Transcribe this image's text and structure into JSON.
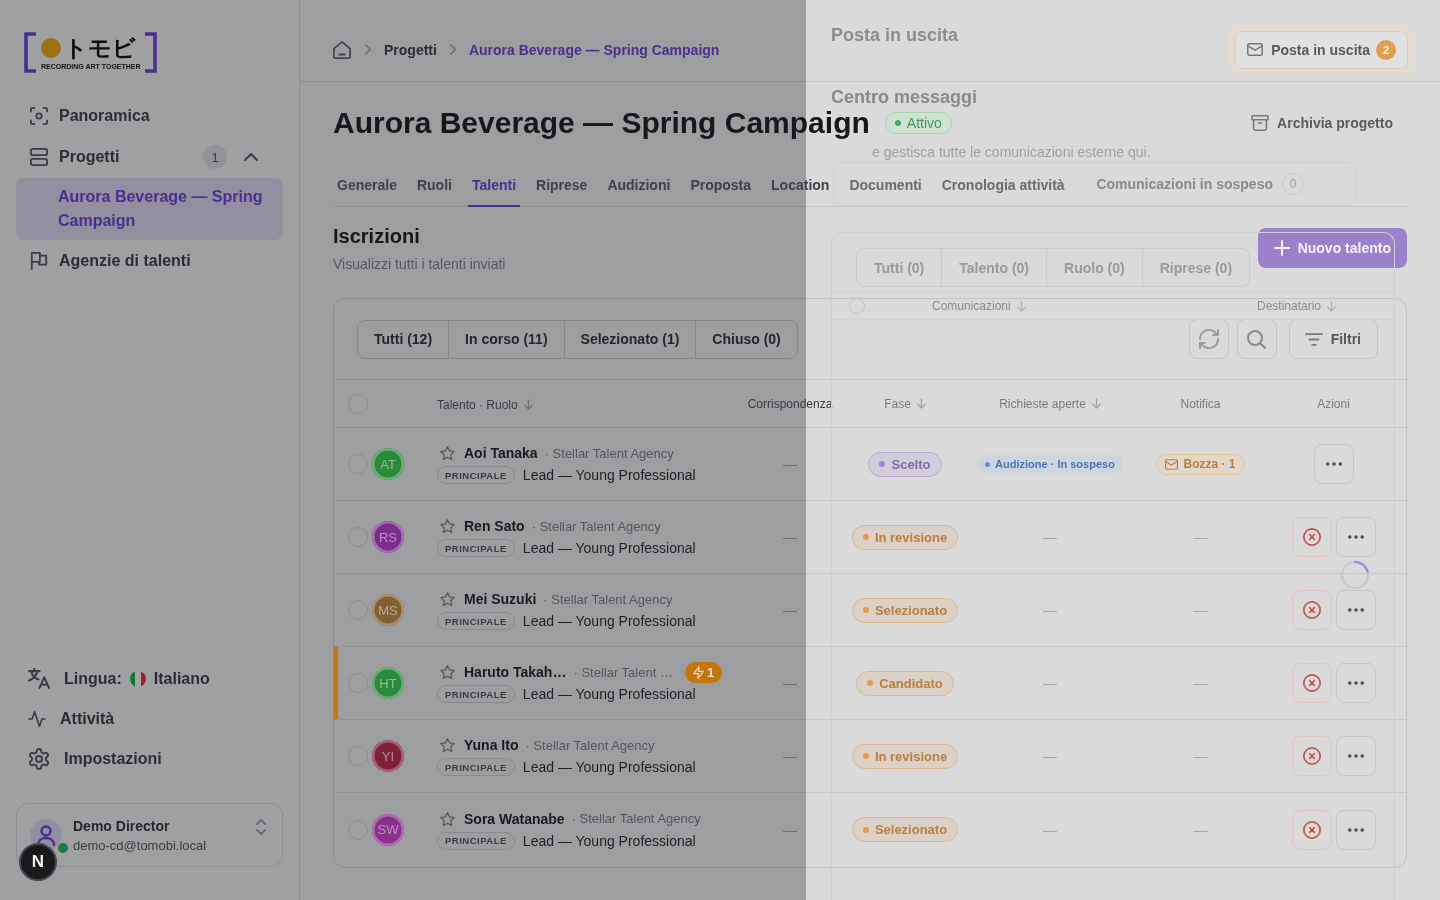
{
  "sidebar": {
    "logo": {
      "wordmark": "トモビ",
      "tagline": "RECORDING ART TOGETHER"
    },
    "nav": [
      {
        "kind": "link",
        "label": "Panoramica",
        "selected": false
      },
      {
        "kind": "group",
        "label": "Progetti",
        "count": "1",
        "selected": false,
        "expanded": true,
        "children": [
          {
            "label": "Aurora Beverage — Spring Campaign",
            "selected": true
          }
        ]
      },
      {
        "kind": "link",
        "label": "Agenzie di talenti",
        "selected": false
      }
    ],
    "language": {
      "label": "Lingua:",
      "value": "Italiano"
    },
    "links": [
      {
        "label": "Attività"
      },
      {
        "label": "Impostazioni"
      }
    ],
    "user": {
      "name": "Demo Director",
      "email": "demo-cd@tomobi.local",
      "online": true
    }
  },
  "dev_indicator": {
    "label": "N"
  },
  "header": {
    "breadcrumb": [
      {
        "label": "Progetti",
        "current": false
      },
      {
        "label": "Aurora Beverage — Spring Campaign",
        "current": true
      }
    ],
    "outbox_button": {
      "label": "Posta in uscita",
      "count": "2"
    }
  },
  "project": {
    "title": "Aurora Beverage — Spring Campaign",
    "status": "Attivo",
    "archive_button": "Archivia progetto"
  },
  "tabs": [
    {
      "label": "Generale",
      "selected": false
    },
    {
      "label": "Ruoli",
      "selected": false
    },
    {
      "label": "Talenti",
      "selected": true
    },
    {
      "label": "Riprese",
      "selected": false
    },
    {
      "label": "Audizioni",
      "selected": false
    },
    {
      "label": "Proposta",
      "selected": false
    },
    {
      "label": "Location",
      "selected": false
    },
    {
      "label": "Documenti",
      "selected": false
    },
    {
      "label": "Cronologia attività",
      "selected": false
    }
  ],
  "section": {
    "title": "Iscrizioni",
    "subtitle": "Visualizzi tutti i talenti inviati",
    "new_button": "Nuovo talento"
  },
  "filters": {
    "segments": [
      {
        "label": "Tutti (12)"
      },
      {
        "label": "In corso (11)"
      },
      {
        "label": "Selezionato (1)"
      },
      {
        "label": "Chiuso (0)"
      }
    ],
    "filter_button": "Filtri"
  },
  "table": {
    "select_all": {
      "checked": false
    },
    "columns": [
      {
        "label": "Talento · Ruolo",
        "sortable": true
      },
      {
        "label": "Corrispondenza",
        "sortable": false
      },
      {
        "label": "Fase",
        "sortable": true
      },
      {
        "label": "Richieste aperte",
        "sortable": true
      },
      {
        "label": "Notifica",
        "sortable": false
      },
      {
        "label": "Azioni",
        "sortable": false
      }
    ],
    "rows": [
      {
        "checked": false,
        "initials": "AT",
        "color": "#2b8a3b",
        "starred": false,
        "name": "Aoi Tanaka",
        "agency": "· Stellar Talent Agency",
        "role_tag": "PRINCIPALE",
        "role": "Lead — Young Professional",
        "match": "—",
        "phase": {
          "label": "Scelto",
          "color": "#9b82dc"
        },
        "requests": {
          "kind": "badge",
          "label": "Audizione · In sospeso"
        },
        "notification": {
          "kind": "badge",
          "label": "Bozza · 1"
        },
        "rejectable": false,
        "flagged": false
      },
      {
        "checked": false,
        "initials": "RS",
        "color": "#7c2e8e",
        "starred": false,
        "name": "Ren Sato",
        "agency": "· Stellar Talent Agency",
        "role_tag": "PRINCIPALE",
        "role": "Lead — Young Professional",
        "match": "—",
        "phase": {
          "label": "In revisione",
          "color": "#e49a4e"
        },
        "requests": {
          "kind": "text",
          "label": "—"
        },
        "notification": {
          "kind": "text",
          "label": "—"
        },
        "rejectable": true,
        "flagged": false
      },
      {
        "checked": false,
        "initials": "MS",
        "color": "#836034",
        "starred": false,
        "name": "Mei Suzuki",
        "agency": "· Stellar Talent Agency",
        "role_tag": "PRINCIPALE",
        "role": "Lead — Young Professional",
        "match": "—",
        "phase": {
          "label": "Selezionato",
          "color": "#e49a4e"
        },
        "requests": {
          "kind": "text",
          "label": "—"
        },
        "notification": {
          "kind": "text",
          "label": "—"
        },
        "rejectable": true,
        "flagged": false
      },
      {
        "checked": false,
        "initials": "HT",
        "color": "#2b8a3b",
        "starred": false,
        "name": "Haruto Takah…",
        "agency": "· Stellar Talent …",
        "alert": "1",
        "role_tag": "PRINCIPALE",
        "role": "Lead — Young Professional",
        "match": "—",
        "phase": {
          "label": "Candidato",
          "color": "#e49a4e"
        },
        "requests": {
          "kind": "text",
          "label": "—"
        },
        "notification": {
          "kind": "text",
          "label": "—"
        },
        "rejectable": true,
        "flagged": true
      },
      {
        "checked": false,
        "initials": "YI",
        "color": "#7e2039",
        "starred": false,
        "name": "Yuna Ito",
        "agency": "· Stellar Talent Agency",
        "role_tag": "PRINCIPALE",
        "role": "Lead — Young Professional",
        "match": "—",
        "phase": {
          "label": "In revisione",
          "color": "#e49a4e"
        },
        "requests": {
          "kind": "text",
          "label": "—"
        },
        "notification": {
          "kind": "text",
          "label": "—"
        },
        "rejectable": true,
        "flagged": false
      },
      {
        "checked": false,
        "initials": "SW",
        "color": "#8b2f8d",
        "starred": false,
        "name": "Sora Watanabe",
        "agency": "· Stellar Talent Agency",
        "role_tag": "PRINCIPALE",
        "role": "Lead — Young Professional",
        "match": "—",
        "phase": {
          "label": "Selezionato",
          "color": "#e49a4e"
        },
        "requests": {
          "kind": "text",
          "label": "—"
        },
        "notification": {
          "kind": "text",
          "label": "—"
        },
        "rejectable": true,
        "flagged": false
      }
    ]
  },
  "drawer": {
    "title": "Posta in uscita",
    "heading": "Centro messaggi",
    "subtitle": "e gestisca tutte le comunicazioni esterne qui.",
    "tabs": [
      {
        "label": "Comunicazioni in sospeso",
        "count": "0"
      }
    ],
    "segments": [
      {
        "label": "Tutti (0)"
      },
      {
        "label": "Talento (0)"
      },
      {
        "label": "Ruolo (0)"
      },
      {
        "label": "Riprese (0)"
      }
    ],
    "select_all": {
      "checked": false
    },
    "columns": [
      {
        "label": "Comunicazioni",
        "sortable": true
      },
      {
        "label": "Destinatario",
        "sortable": true
      }
    ],
    "loading": true
  }
}
